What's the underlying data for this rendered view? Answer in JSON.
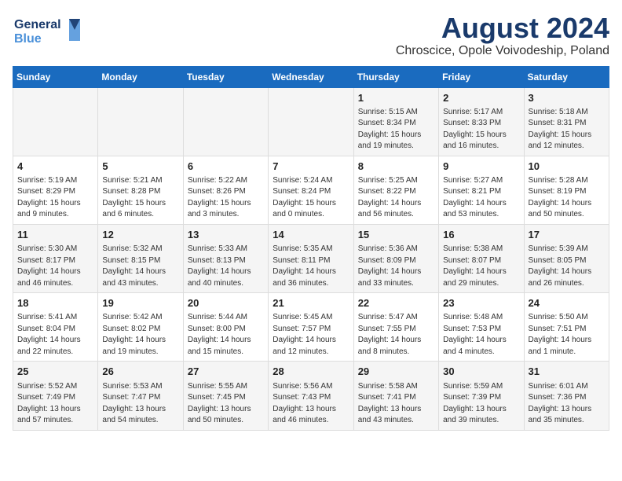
{
  "header": {
    "logo_line1": "General",
    "logo_line2": "Blue",
    "main_title": "August 2024",
    "sub_title": "Chroscice, Opole Voivodeship, Poland"
  },
  "weekdays": [
    "Sunday",
    "Monday",
    "Tuesday",
    "Wednesday",
    "Thursday",
    "Friday",
    "Saturday"
  ],
  "weeks": [
    [
      {
        "day": "",
        "info": ""
      },
      {
        "day": "",
        "info": ""
      },
      {
        "day": "",
        "info": ""
      },
      {
        "day": "",
        "info": ""
      },
      {
        "day": "1",
        "info": "Sunrise: 5:15 AM\nSunset: 8:34 PM\nDaylight: 15 hours\nand 19 minutes."
      },
      {
        "day": "2",
        "info": "Sunrise: 5:17 AM\nSunset: 8:33 PM\nDaylight: 15 hours\nand 16 minutes."
      },
      {
        "day": "3",
        "info": "Sunrise: 5:18 AM\nSunset: 8:31 PM\nDaylight: 15 hours\nand 12 minutes."
      }
    ],
    [
      {
        "day": "4",
        "info": "Sunrise: 5:19 AM\nSunset: 8:29 PM\nDaylight: 15 hours\nand 9 minutes."
      },
      {
        "day": "5",
        "info": "Sunrise: 5:21 AM\nSunset: 8:28 PM\nDaylight: 15 hours\nand 6 minutes."
      },
      {
        "day": "6",
        "info": "Sunrise: 5:22 AM\nSunset: 8:26 PM\nDaylight: 15 hours\nand 3 minutes."
      },
      {
        "day": "7",
        "info": "Sunrise: 5:24 AM\nSunset: 8:24 PM\nDaylight: 15 hours\nand 0 minutes."
      },
      {
        "day": "8",
        "info": "Sunrise: 5:25 AM\nSunset: 8:22 PM\nDaylight: 14 hours\nand 56 minutes."
      },
      {
        "day": "9",
        "info": "Sunrise: 5:27 AM\nSunset: 8:21 PM\nDaylight: 14 hours\nand 53 minutes."
      },
      {
        "day": "10",
        "info": "Sunrise: 5:28 AM\nSunset: 8:19 PM\nDaylight: 14 hours\nand 50 minutes."
      }
    ],
    [
      {
        "day": "11",
        "info": "Sunrise: 5:30 AM\nSunset: 8:17 PM\nDaylight: 14 hours\nand 46 minutes."
      },
      {
        "day": "12",
        "info": "Sunrise: 5:32 AM\nSunset: 8:15 PM\nDaylight: 14 hours\nand 43 minutes."
      },
      {
        "day": "13",
        "info": "Sunrise: 5:33 AM\nSunset: 8:13 PM\nDaylight: 14 hours\nand 40 minutes."
      },
      {
        "day": "14",
        "info": "Sunrise: 5:35 AM\nSunset: 8:11 PM\nDaylight: 14 hours\nand 36 minutes."
      },
      {
        "day": "15",
        "info": "Sunrise: 5:36 AM\nSunset: 8:09 PM\nDaylight: 14 hours\nand 33 minutes."
      },
      {
        "day": "16",
        "info": "Sunrise: 5:38 AM\nSunset: 8:07 PM\nDaylight: 14 hours\nand 29 minutes."
      },
      {
        "day": "17",
        "info": "Sunrise: 5:39 AM\nSunset: 8:05 PM\nDaylight: 14 hours\nand 26 minutes."
      }
    ],
    [
      {
        "day": "18",
        "info": "Sunrise: 5:41 AM\nSunset: 8:04 PM\nDaylight: 14 hours\nand 22 minutes."
      },
      {
        "day": "19",
        "info": "Sunrise: 5:42 AM\nSunset: 8:02 PM\nDaylight: 14 hours\nand 19 minutes."
      },
      {
        "day": "20",
        "info": "Sunrise: 5:44 AM\nSunset: 8:00 PM\nDaylight: 14 hours\nand 15 minutes."
      },
      {
        "day": "21",
        "info": "Sunrise: 5:45 AM\nSunset: 7:57 PM\nDaylight: 14 hours\nand 12 minutes."
      },
      {
        "day": "22",
        "info": "Sunrise: 5:47 AM\nSunset: 7:55 PM\nDaylight: 14 hours\nand 8 minutes."
      },
      {
        "day": "23",
        "info": "Sunrise: 5:48 AM\nSunset: 7:53 PM\nDaylight: 14 hours\nand 4 minutes."
      },
      {
        "day": "24",
        "info": "Sunrise: 5:50 AM\nSunset: 7:51 PM\nDaylight: 14 hours\nand 1 minute."
      }
    ],
    [
      {
        "day": "25",
        "info": "Sunrise: 5:52 AM\nSunset: 7:49 PM\nDaylight: 13 hours\nand 57 minutes."
      },
      {
        "day": "26",
        "info": "Sunrise: 5:53 AM\nSunset: 7:47 PM\nDaylight: 13 hours\nand 54 minutes."
      },
      {
        "day": "27",
        "info": "Sunrise: 5:55 AM\nSunset: 7:45 PM\nDaylight: 13 hours\nand 50 minutes."
      },
      {
        "day": "28",
        "info": "Sunrise: 5:56 AM\nSunset: 7:43 PM\nDaylight: 13 hours\nand 46 minutes."
      },
      {
        "day": "29",
        "info": "Sunrise: 5:58 AM\nSunset: 7:41 PM\nDaylight: 13 hours\nand 43 minutes."
      },
      {
        "day": "30",
        "info": "Sunrise: 5:59 AM\nSunset: 7:39 PM\nDaylight: 13 hours\nand 39 minutes."
      },
      {
        "day": "31",
        "info": "Sunrise: 6:01 AM\nSunset: 7:36 PM\nDaylight: 13 hours\nand 35 minutes."
      }
    ]
  ]
}
